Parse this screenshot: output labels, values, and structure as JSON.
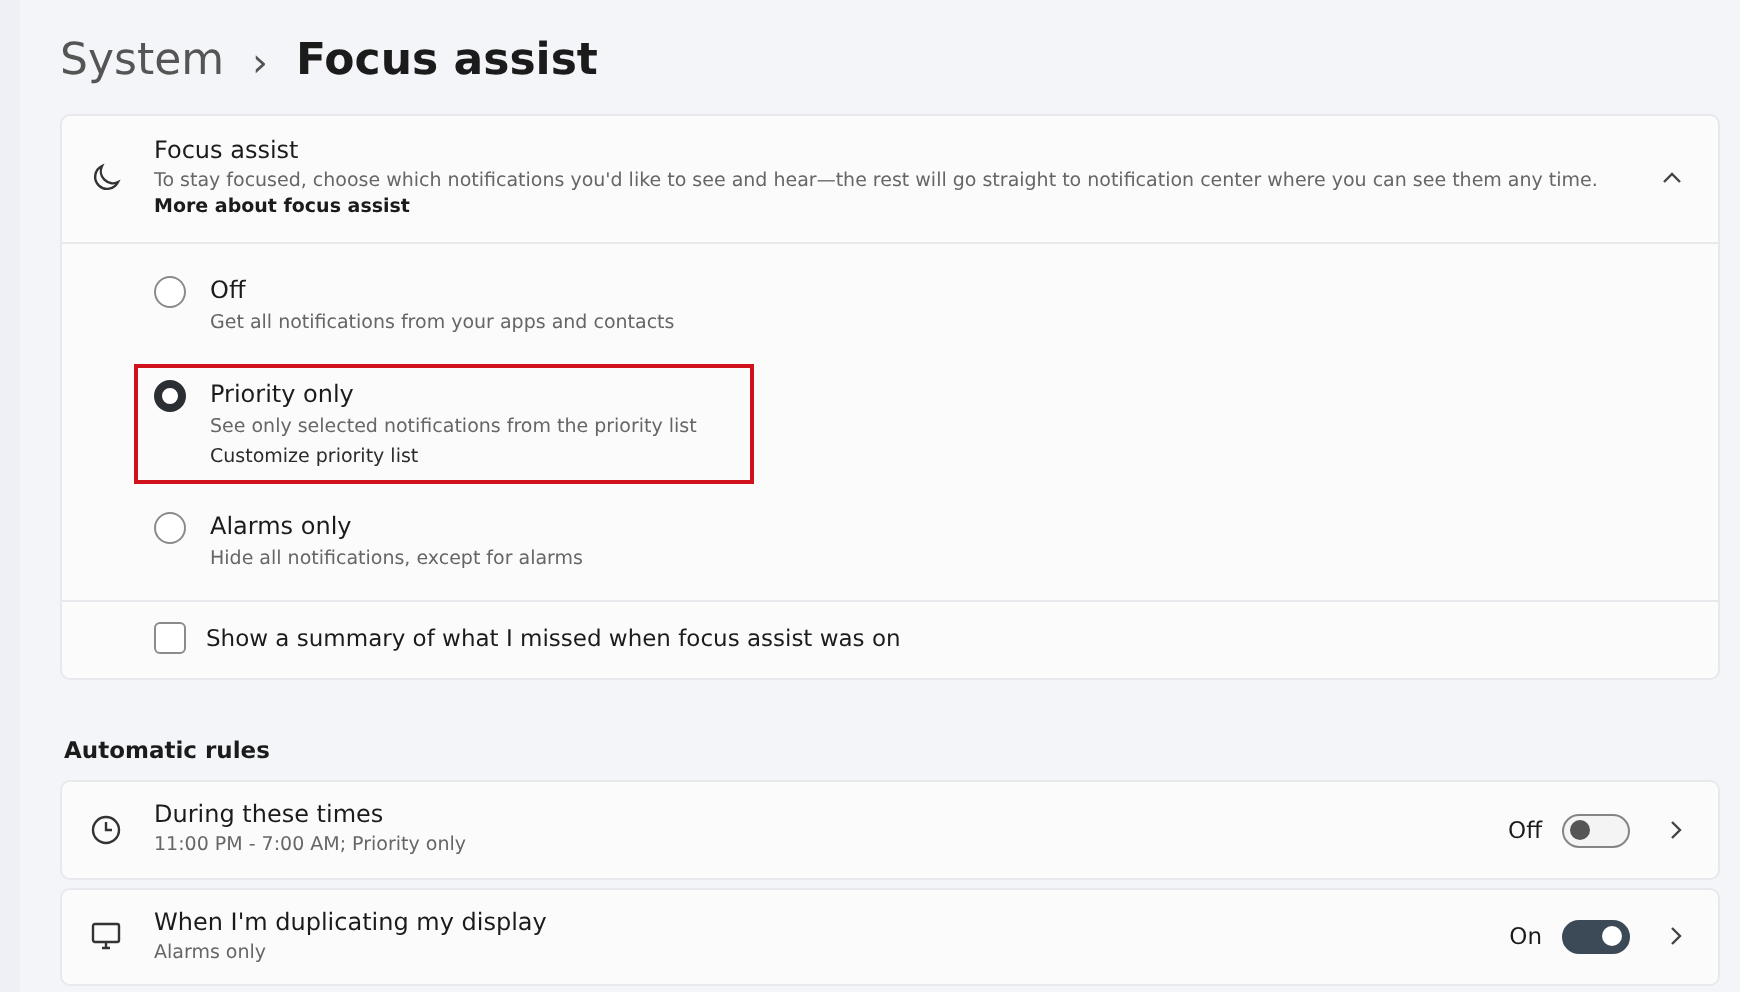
{
  "breadcrumb": {
    "parent": "System",
    "separator": "›",
    "current": "Focus assist"
  },
  "focus_card": {
    "title": "Focus assist",
    "description": "To stay focused, choose which notifications you'd like to see and hear—the rest will go straight to notification center where you can see them any time. **More about focus assist**",
    "expanded": true,
    "options": [
      {
        "label": "Off",
        "description": "Get all notifications from your apps and contacts",
        "selected": false,
        "highlighted": false
      },
      {
        "label": "Priority only",
        "description": "See only selected notifications from the priority list",
        "link": "Customize priority list",
        "selected": true,
        "highlighted": true
      },
      {
        "label": "Alarms only",
        "description": "Hide all notifications, except for alarms",
        "selected": false,
        "highlighted": false
      }
    ],
    "summary_checkbox": {
      "label": "Show a summary of what I missed when focus assist was on",
      "checked": false
    }
  },
  "rules_heading": "Automatic rules",
  "rules": [
    {
      "kind": "clock",
      "title": "During these times",
      "subtitle": "11:00 PM - 7:00 AM; Priority only",
      "state_label": "Off",
      "on": false
    },
    {
      "kind": "monitor",
      "title": "When I'm duplicating my display",
      "subtitle": "Alarms only",
      "state_label": "On",
      "on": true
    }
  ]
}
